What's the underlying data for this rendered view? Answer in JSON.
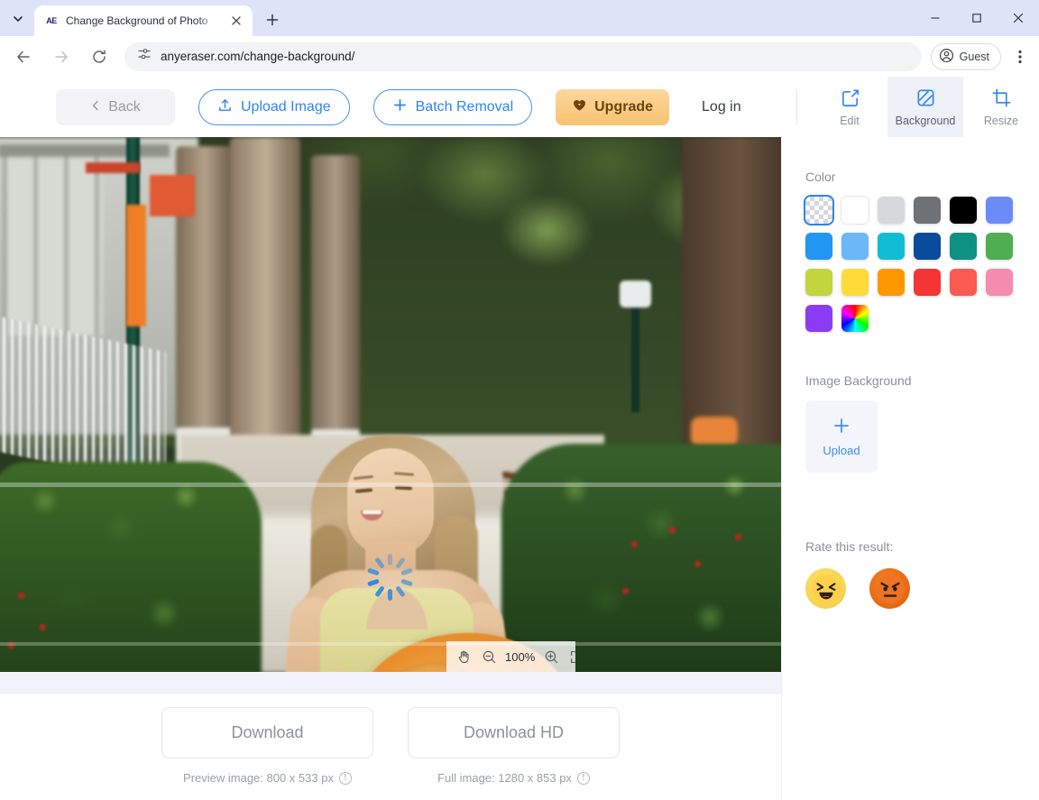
{
  "browser": {
    "tab": {
      "title": "Change Background of Photo",
      "favicon_text": "AE",
      "favicon_name": "anyeraser-favicon"
    },
    "new_tab_tooltip": "New Tab",
    "url": "anyeraser.com/change-background/",
    "profile_label": "Guest",
    "window_controls": {
      "minimize": "–",
      "maximize": "☐",
      "close": "✕"
    }
  },
  "header": {
    "back_label": "Back",
    "upload_label": "Upload Image",
    "batch_label": "Batch Removal",
    "upgrade_label": "Upgrade",
    "login_label": "Log in",
    "modes": [
      {
        "label": "Edit",
        "icon": "edit-square-icon",
        "active": false
      },
      {
        "label": "Background",
        "icon": "background-square-icon",
        "active": true
      },
      {
        "label": "Resize",
        "icon": "crop-icon",
        "active": false
      }
    ]
  },
  "canvas": {
    "zoom_level": "100%",
    "tools": [
      {
        "name": "hand-tool-icon"
      },
      {
        "name": "zoom-out-icon"
      },
      {
        "name": "zoom-in-icon"
      },
      {
        "name": "fit-screen-icon"
      },
      {
        "name": "compare-split-icon"
      }
    ],
    "image_alt": "Woman in yellow top holding an orange sun hat on a garden path"
  },
  "download": {
    "preview": {
      "button_label": "Download",
      "note": "Preview image: 800 x 533 px",
      "info_icon": "info-icon"
    },
    "hd": {
      "button_label": "Download HD",
      "note": "Full image: 1280 x 853 px",
      "info_icon": "info-icon"
    }
  },
  "sidebar": {
    "color_section_label": "Color",
    "image_bg_section_label": "Image Background",
    "rate_section_label": "Rate this result:",
    "upload_label": "Upload",
    "swatches": [
      {
        "name": "transparent",
        "type": "checker",
        "selected": true
      },
      {
        "name": "white",
        "color": "#ffffff",
        "bordered": true
      },
      {
        "name": "light-gray",
        "color": "#d6d8dc"
      },
      {
        "name": "gray",
        "color": "#6e7175"
      },
      {
        "name": "black",
        "color": "#000000"
      },
      {
        "name": "periwinkle",
        "color": "#6b8cf7"
      },
      {
        "name": "blue",
        "color": "#2196f3"
      },
      {
        "name": "light-blue",
        "color": "#6ab8f7"
      },
      {
        "name": "cyan",
        "color": "#11bdd4"
      },
      {
        "name": "navy",
        "color": "#0b4b9c"
      },
      {
        "name": "teal",
        "color": "#0d9183"
      },
      {
        "name": "green",
        "color": "#4fae52"
      },
      {
        "name": "lime",
        "color": "#c2d43e"
      },
      {
        "name": "yellow",
        "color": "#ffdb3a"
      },
      {
        "name": "orange",
        "color": "#ff9800"
      },
      {
        "name": "red",
        "color": "#f43535"
      },
      {
        "name": "coral",
        "color": "#fa5a52"
      },
      {
        "name": "pink",
        "color": "#f58bae"
      },
      {
        "name": "purple",
        "color": "#8b3cf2"
      },
      {
        "name": "color-picker",
        "type": "rainbow"
      }
    ],
    "rate_buttons": [
      {
        "name": "rate-happy",
        "emoji": "happy"
      },
      {
        "name": "rate-angry",
        "emoji": "angry"
      }
    ]
  }
}
